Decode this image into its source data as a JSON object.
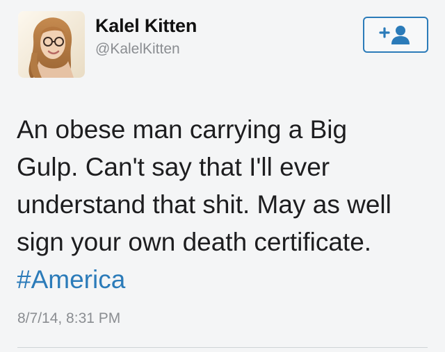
{
  "author": {
    "display_name": "Kalel Kitten",
    "handle": "@KalelKitten",
    "avatar_icon": "profile-photo"
  },
  "follow_button": {
    "icon": "add-user-icon",
    "label": "+",
    "accent_color": "#2b7bb9"
  },
  "tweet": {
    "lines": [
      "An obese man carrying a Big",
      "Gulp. Can't say that I'll ever",
      "understand that shit. May as well",
      "sign your own death certificate."
    ],
    "hashtag": "#America",
    "timestamp": "8/7/14, 8:31 PM"
  }
}
